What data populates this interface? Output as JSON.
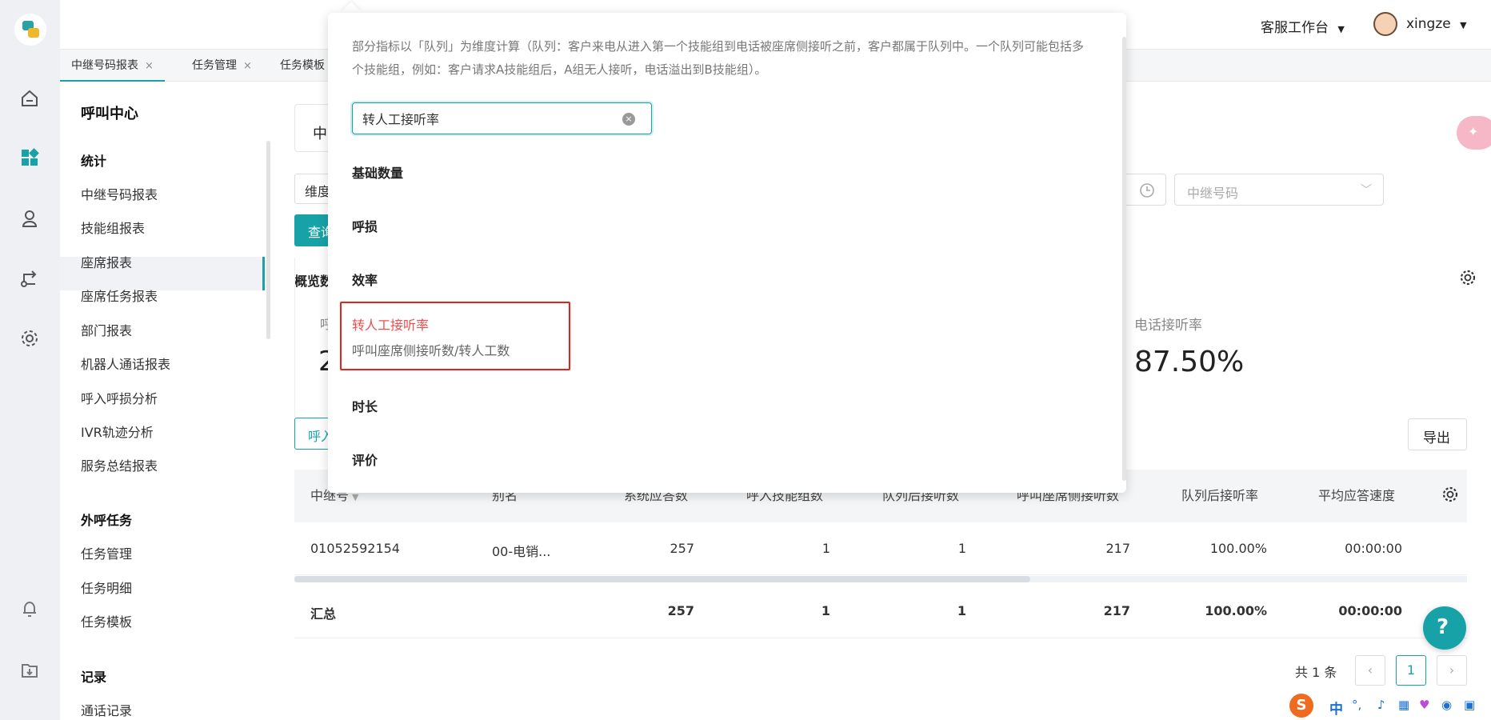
{
  "header": {
    "workbench_label": "客服工作台",
    "username": "xingze"
  },
  "tabs": [
    {
      "label": "中继号码报表",
      "close": "×"
    },
    {
      "label": "任务管理",
      "close": "×"
    },
    {
      "label": "任务模板"
    }
  ],
  "sidebar": {
    "title": "呼叫中心",
    "sections": [
      {
        "title": "统计",
        "items": [
          "中继号码报表",
          "技能组报表",
          "座席报表",
          "座席任务报表",
          "部门报表",
          "机器人通话报表",
          "呼入呼损分析",
          "IVR轨迹分析",
          "服务总结报表"
        ]
      },
      {
        "title": "外呼任务",
        "items": [
          "任务管理",
          "任务明细",
          "任务模板"
        ]
      },
      {
        "title": "记录",
        "items": [
          "通话记录"
        ]
      }
    ]
  },
  "main": {
    "page_heading_partial": "中",
    "dimension_partial": "维度",
    "query_partial": "查询",
    "trunk_placeholder": "中继号码",
    "overview_partial": "概览数",
    "stat_label_partial": "呼",
    "stat_value_partial": "2",
    "answer_rate_label": "电话接听率",
    "answer_rate_value": "87.50%",
    "tab_partial": "呼入",
    "export_label": "导出"
  },
  "popup": {
    "note": "部分指标以「队列」为维度计算（队列：客户来电从进入第一个技能组到电话被座席侧接听之前，客户都属于队列中。一个队列可能包括多个技能组，例如：客户请求A技能组后，A组无人接听，电话溢出到B技能组）。",
    "search_value": "转人工接听率",
    "categories": [
      "基础数量",
      "呼损",
      "效率",
      "时长",
      "评价"
    ],
    "result": {
      "name": "转人工接听率",
      "desc": "呼叫座席侧接听数/转人工数"
    }
  },
  "table": {
    "headers": [
      "中继号",
      "别名",
      "系统应答数",
      "呼入技能组数",
      "队列后接听数",
      "呼叫座席侧接听数",
      "队列后接听率",
      "平均应答速度"
    ],
    "rows": [
      [
        "01052592154",
        "00-电销...",
        "257",
        "1",
        "1",
        "217",
        "100.00%",
        "00:00:00"
      ]
    ],
    "total": [
      "汇总",
      "",
      "257",
      "1",
      "1",
      "217",
      "100.00%",
      "00:00:00"
    ]
  },
  "pagination": {
    "total_text": "共 1 条",
    "current_page": "1"
  },
  "ime": {
    "lang": "中",
    "punct": "°,"
  },
  "colors": {
    "accent": "#17a2a8",
    "highlight_border": "#e3241b",
    "highlight_text": "#f04d4d"
  }
}
